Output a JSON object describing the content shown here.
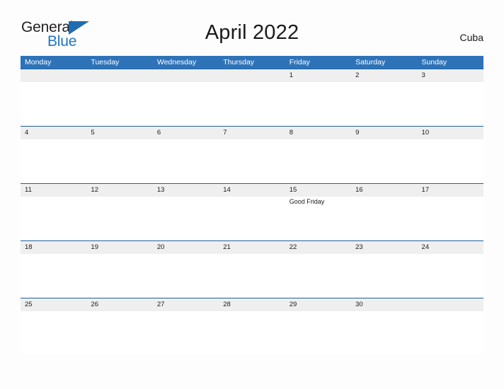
{
  "branding": {
    "name_part1": "General",
    "name_part2": "Blue",
    "triangle_color": "#1f6cb0",
    "blue_color": "#1f76c4"
  },
  "header": {
    "title": "April 2022",
    "country": "Cuba"
  },
  "theme": {
    "header_blue": "#2e73b8",
    "date_band_gray": "#efefef",
    "row_border": "#1f5fa0",
    "page_background": "#fdfdfd",
    "text_color": "#1a1a1a"
  },
  "calendar": {
    "month": "April",
    "year": "2022",
    "weekday_headers": [
      "Monday",
      "Tuesday",
      "Wednesday",
      "Thursday",
      "Friday",
      "Saturday",
      "Sunday"
    ],
    "weeks": [
      {
        "days": [
          {
            "date": "",
            "events": []
          },
          {
            "date": "",
            "events": []
          },
          {
            "date": "",
            "events": []
          },
          {
            "date": "",
            "events": []
          },
          {
            "date": "1",
            "events": []
          },
          {
            "date": "2",
            "events": []
          },
          {
            "date": "3",
            "events": []
          }
        ]
      },
      {
        "days": [
          {
            "date": "4",
            "events": []
          },
          {
            "date": "5",
            "events": []
          },
          {
            "date": "6",
            "events": []
          },
          {
            "date": "7",
            "events": []
          },
          {
            "date": "8",
            "events": []
          },
          {
            "date": "9",
            "events": []
          },
          {
            "date": "10",
            "events": []
          }
        ]
      },
      {
        "days": [
          {
            "date": "11",
            "events": []
          },
          {
            "date": "12",
            "events": []
          },
          {
            "date": "13",
            "events": []
          },
          {
            "date": "14",
            "events": []
          },
          {
            "date": "15",
            "events": [
              "Good Friday"
            ]
          },
          {
            "date": "16",
            "events": []
          },
          {
            "date": "17",
            "events": []
          }
        ]
      },
      {
        "days": [
          {
            "date": "18",
            "events": []
          },
          {
            "date": "19",
            "events": []
          },
          {
            "date": "20",
            "events": []
          },
          {
            "date": "21",
            "events": []
          },
          {
            "date": "22",
            "events": []
          },
          {
            "date": "23",
            "events": []
          },
          {
            "date": "24",
            "events": []
          }
        ]
      },
      {
        "days": [
          {
            "date": "25",
            "events": []
          },
          {
            "date": "26",
            "events": []
          },
          {
            "date": "27",
            "events": []
          },
          {
            "date": "28",
            "events": []
          },
          {
            "date": "29",
            "events": []
          },
          {
            "date": "30",
            "events": []
          },
          {
            "date": "",
            "events": []
          }
        ]
      }
    ]
  }
}
